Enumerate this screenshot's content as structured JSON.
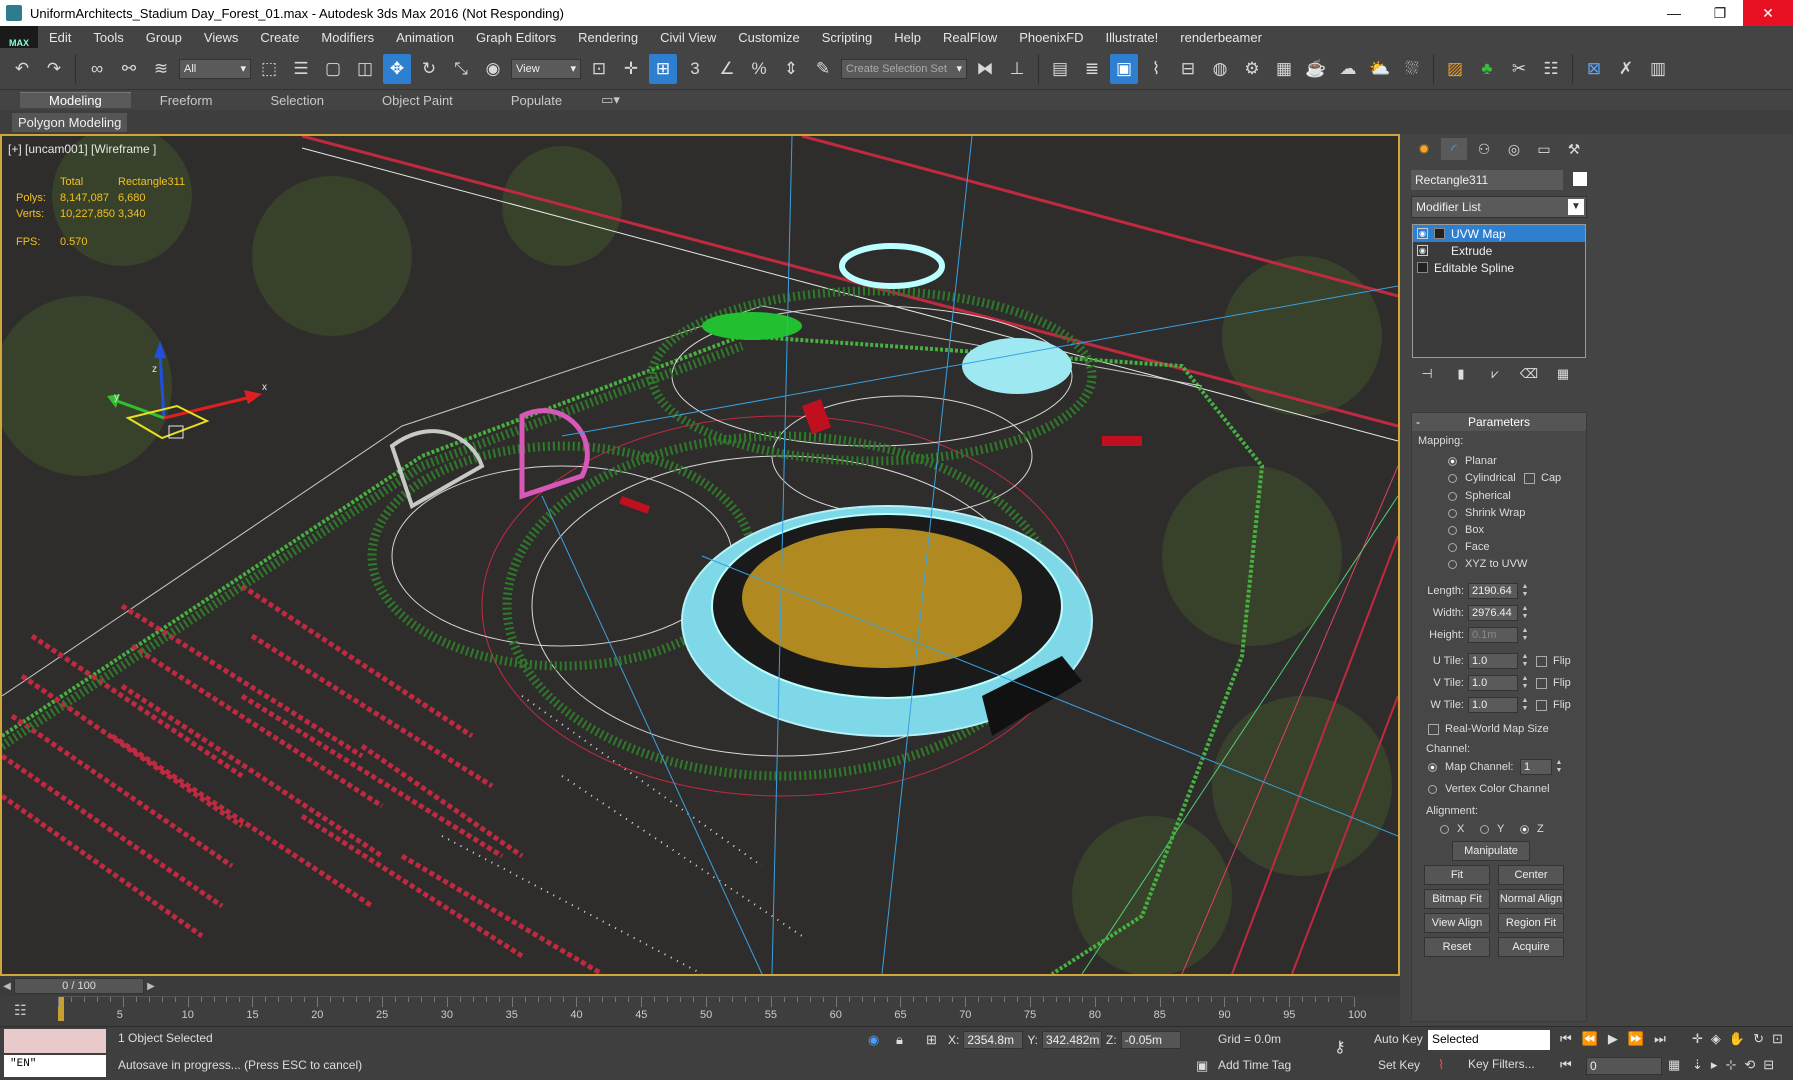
{
  "window": {
    "title": "UniformArchitects_Stadium Day_Forest_01.max - Autodesk 3ds Max 2016  (Not Responding)",
    "minimize": "—",
    "restore": "❐",
    "close": "✕"
  },
  "menu": {
    "logo": "MAX",
    "items": [
      "Edit",
      "Tools",
      "Group",
      "Views",
      "Create",
      "Modifiers",
      "Animation",
      "Graph Editors",
      "Rendering",
      "Civil View",
      "Customize",
      "Scripting",
      "Help",
      "RealFlow",
      "PhoenixFD",
      "Illustrate!",
      "renderbeamer"
    ]
  },
  "toolbar": {
    "selection_filter": "All",
    "ref_coord": "View",
    "named_selection_placeholder": "Create Selection Set",
    "snap_label": "3"
  },
  "ribbon": {
    "tabs": [
      "Modeling",
      "Freeform",
      "Selection",
      "Object Paint",
      "Populate"
    ],
    "panel": "Polygon Modeling"
  },
  "viewport": {
    "label": "[+] [uncam001] [Wireframe ]",
    "stats": {
      "header_total": "Total",
      "header_object": "Rectangle311",
      "polys_label": "Polys:",
      "polys_total": "8,147,087",
      "polys_object": "6,680",
      "verts_label": "Verts:",
      "verts_total": "10,227,850",
      "verts_object": "3,340",
      "fps_label": "FPS:",
      "fps_value": "0.570"
    },
    "gizmo": {
      "x": "x",
      "y": "y",
      "z": "z"
    }
  },
  "command_panel": {
    "object_name": "Rectangle311",
    "modifier_list": "Modifier List",
    "stack": [
      "UVW Map",
      "Extrude",
      "Editable Spline"
    ],
    "rollout": "Parameters",
    "mapping_label": "Mapping:",
    "mapping_options": [
      "Planar",
      "Cylindrical",
      "Spherical",
      "Shrink Wrap",
      "Box",
      "Face",
      "XYZ to UVW"
    ],
    "cap_label": "Cap",
    "length_label": "Length:",
    "length": "2190.64",
    "width_label": "Width:",
    "width": "2976.44",
    "height_label": "Height:",
    "height": "0.1m",
    "utile_label": "U Tile:",
    "utile": "1.0",
    "vtile_label": "V Tile:",
    "vtile": "1.0",
    "wtile_label": "W Tile:",
    "wtile": "1.0",
    "flip_label": "Flip",
    "realworld": "Real-World Map Size",
    "channel_label": "Channel:",
    "map_channel_label": "Map Channel:",
    "map_channel": "1",
    "vertex_color_channel": "Vertex Color Channel",
    "alignment_label": "Alignment:",
    "axis_x": "X",
    "axis_y": "Y",
    "axis_z": "Z",
    "buttons": {
      "manipulate": "Manipulate",
      "fit": "Fit",
      "center": "Center",
      "bitmap_fit": "Bitmap Fit",
      "normal_align": "Normal Align",
      "view_align": "View Align",
      "region_fit": "Region Fit",
      "reset": "Reset",
      "acquire": "Acquire"
    }
  },
  "timeline": {
    "slider": "0 / 100",
    "ticks": [
      "5",
      "10",
      "15",
      "20",
      "25",
      "30",
      "35",
      "40",
      "45",
      "50",
      "55",
      "60",
      "65",
      "70",
      "75",
      "80",
      "85",
      "90",
      "95",
      "100"
    ]
  },
  "status": {
    "selection": "1 Object Selected",
    "prompt": "Autosave in progress... (Press ESC to cancel)",
    "maxscript_text": "\"EN\"",
    "x_label": "X:",
    "x": "2354.8m",
    "y_label": "Y:",
    "y": "342.482m",
    "z_label": "Z:",
    "z": "-0.05m",
    "grid": "Grid = 0.0m",
    "add_time_tag": "Add Time Tag",
    "auto_key": "Auto Key",
    "set_key": "Set Key",
    "selected": "Selected",
    "key_filters": "Key Filters...",
    "frame": "0"
  }
}
